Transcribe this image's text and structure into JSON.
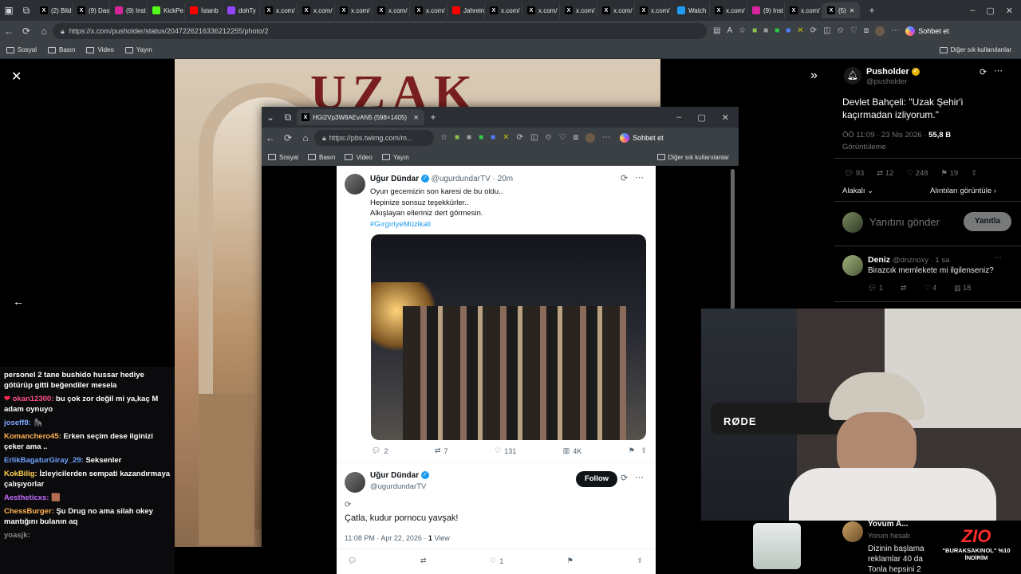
{
  "browser": {
    "tabs": [
      {
        "label": "(2) Bild",
        "icon": "x-icon",
        "color": "#000000"
      },
      {
        "label": "(9) Das",
        "icon": "x-icon",
        "color": "#000000"
      },
      {
        "label": "(9) Inst",
        "icon": "instagram-icon",
        "color": "#d6249f"
      },
      {
        "label": "KickPe",
        "icon": "kick-icon",
        "color": "#53fc18"
      },
      {
        "label": "İstanb",
        "icon": "youtube-icon",
        "color": "#ff0000"
      },
      {
        "label": "dohTy",
        "icon": "twitch-icon",
        "color": "#9146ff"
      },
      {
        "label": "x.com/",
        "icon": "x-icon",
        "color": "#000000"
      },
      {
        "label": "x.com/",
        "icon": "x-icon",
        "color": "#000000"
      },
      {
        "label": "x.com/",
        "icon": "x-icon",
        "color": "#000000"
      },
      {
        "label": "x.com/",
        "icon": "x-icon",
        "color": "#000000"
      },
      {
        "label": "x.com/",
        "icon": "x-icon",
        "color": "#000000"
      },
      {
        "label": "Jahrein",
        "icon": "youtube-icon",
        "color": "#ff0000"
      },
      {
        "label": "x.com/",
        "icon": "x-icon",
        "color": "#000000"
      },
      {
        "label": "x.com/",
        "icon": "x-icon",
        "color": "#000000"
      },
      {
        "label": "x.com/",
        "icon": "x-icon",
        "color": "#000000"
      },
      {
        "label": "x.com/",
        "icon": "x-icon",
        "color": "#000000"
      },
      {
        "label": "x.com/",
        "icon": "x-icon",
        "color": "#000000"
      },
      {
        "label": "Watch",
        "icon": "globe-icon",
        "color": "#1d9bf0"
      },
      {
        "label": "x.com/",
        "icon": "x-icon",
        "color": "#000000"
      },
      {
        "label": "(9) Inst",
        "icon": "instagram-icon",
        "color": "#d6249f"
      },
      {
        "label": "x.com/",
        "icon": "x-icon",
        "color": "#000000"
      },
      {
        "label": "(5)",
        "icon": "x-icon",
        "color": "#000000",
        "active": true
      }
    ],
    "url": "https://x.com/pusholder/status/2047226216336212255/photo/2",
    "copilot_label": "Sohbet et",
    "bookmarks": [
      "Sosyal",
      "Basın",
      "Video",
      "Yayın"
    ],
    "other_bookmarks": "Diğer sık kullanılanlar"
  },
  "popup": {
    "tab_title": "HGi2Vp3W8AEvAN5 (598×1405)",
    "url": "https://pbs.twimg.com/m...",
    "copilot_label": "Sohbet et",
    "bookmarks": [
      "Sosyal",
      "Basın",
      "Video",
      "Yayın"
    ],
    "other_bookmarks": "Diğer sık kullanılanlar",
    "tweet1": {
      "name": "Uğur Dündar",
      "handle": "@ugurdundarTV · 20m",
      "lines": [
        "Oyun gecemizin son karesi de bu oldu..",
        "Hepinize sonsuz teşekkürler..",
        "Alkışlayan elleriniz dert görmesin."
      ],
      "hashtag": "#GırgıriyeMüzikali",
      "replies": "2",
      "retweets": "7",
      "likes": "131",
      "views": "4K"
    },
    "tweet2": {
      "name": "Uğur Dündar",
      "handle": "@ugurdundarTV",
      "follow": "Follow",
      "text": "Çatla, kudur pornocu yavşak!",
      "time": "11:08 PM · Apr 22, 2026 ·",
      "views_count": "1",
      "views_label": "View",
      "likes": "1"
    }
  },
  "photo_title": "UZAK",
  "right": {
    "name": "Pusholder",
    "handle": "@pusholder",
    "text": "Devlet Bahçeli: \"Uzak Şehir'i kaçırmadan izliyorum.\"",
    "time": "ÖÖ 11:09 · 23 Nis 2026 ·",
    "views": "55,8 B",
    "views_label": "Görüntüleme",
    "stats": {
      "replies": "93",
      "retweets": "12",
      "likes": "248",
      "bookmarks": "19"
    },
    "sort_label": "Alakalı",
    "quotes_label": "Alıntıları görüntüle",
    "reply_placeholder": "Yanıtını gönder",
    "reply_button": "Yanıtla",
    "reply": {
      "name": "Deniz",
      "handle": "@dnznoxy · 1 sa",
      "text": "Birazcık memlekete mi ilgilenseniz?",
      "replies": "1",
      "likes": "4",
      "views": "18"
    },
    "reply2": {
      "name": "Yovum A...",
      "handle": "Yorum hesab",
      "lines": [
        "Dizinin başlama",
        "reklamlar 40 da",
        "Tonla hepsini 2"
      ]
    }
  },
  "chat": [
    {
      "user": "",
      "color": "#ffffff",
      "text": "personel 2 tane bushido hussar hediye götürüp gitti beğendiler mesela"
    },
    {
      "user": "okan12300:",
      "color": "#ff4f8a",
      "text": "bu çok zor değil mi ya,kaç M adam oynuyo",
      "badge": "heart"
    },
    {
      "user": "joseff8:",
      "color": "#7ea6ff",
      "text": "🦍"
    },
    {
      "user": "Komanchero45:",
      "color": "#ffb04f",
      "text": "Erken seçim dese ilginizi çeker ama .."
    },
    {
      "user": "ErlikBagaturGiray_29:",
      "color": "#6fa0ff",
      "text": "Seksenler"
    },
    {
      "user": "KokBilig:",
      "color": "#ffd24f",
      "text": "İzleyicilerden sempati kazandırmaya çalışıyorlar"
    },
    {
      "user": "Aestheticxs:",
      "color": "#c46bff",
      "text": "🟫"
    },
    {
      "user": "ChessBurger:",
      "color": "#ffb04f",
      "text": "Şu Drug no ama silah okey mantığını bulanın aq"
    },
    {
      "user": "yoasjk:",
      "color": "#888888",
      "text": ""
    }
  ],
  "overlay": {
    "brand": "ZIO",
    "promo": "\"BURAKSAKINOL\" %10 İNDİRİM",
    "mic_label": "RØDE"
  }
}
